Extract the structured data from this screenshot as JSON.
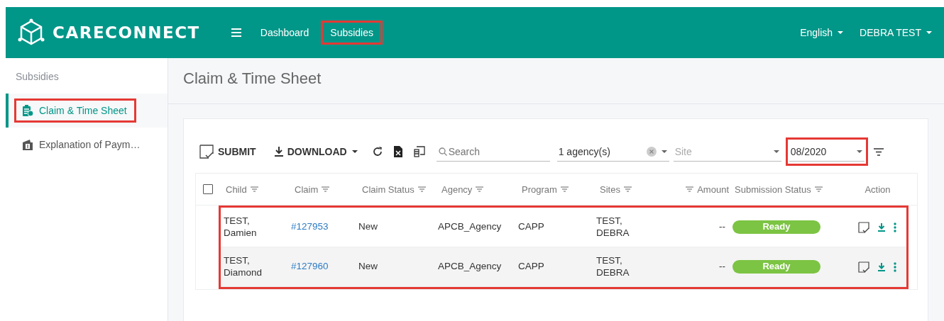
{
  "header": {
    "brand": "CARECONNECT",
    "nav": [
      {
        "label": "Dashboard",
        "highlighted": false
      },
      {
        "label": "Subsidies",
        "highlighted": true
      }
    ],
    "language": "English",
    "user": "DEBRA TEST"
  },
  "sidebar": {
    "heading": "Subsidies",
    "items": [
      {
        "label": "Claim & Time Sheet",
        "selected": true,
        "highlighted": true,
        "kind": "clipboard"
      },
      {
        "label": "Explanation of Paym…",
        "selected": false,
        "highlighted": false,
        "kind": "money"
      }
    ]
  },
  "page": {
    "title": "Claim & Time Sheet"
  },
  "toolbar": {
    "submit": "SUBMIT",
    "download": "DOWNLOAD",
    "search": {
      "placeholder": "Search"
    },
    "agency": {
      "value": "1 agency(s)"
    },
    "site": {
      "placeholder": "Site"
    },
    "period": {
      "value": "08/2020",
      "highlighted": true
    }
  },
  "table": {
    "select_all": {
      "checked": false
    },
    "columns": [
      {
        "label": "Child",
        "kind": "filterable"
      },
      {
        "label": "Claim",
        "kind": "filterable"
      },
      {
        "label": "Claim Status",
        "kind": "filterable"
      },
      {
        "label": "Agency",
        "kind": "filterable"
      },
      {
        "label": "Program",
        "kind": "filterable"
      },
      {
        "label": "Sites",
        "kind": "filterable"
      },
      {
        "label": "Amount",
        "kind": "numeric"
      },
      {
        "label": "Submission Status",
        "kind": "filterable"
      },
      {
        "label": "Action",
        "kind": "actions"
      }
    ],
    "rows_highlighted": true,
    "rows": [
      {
        "child": "TEST,\nDamien",
        "claim": "#127953",
        "claim_status": "New",
        "agency": "APCB_Agency",
        "program": "CAPP",
        "sites": "TEST,\nDEBRA",
        "amount": "--",
        "submission_status": "Ready"
      },
      {
        "child": "TEST,\nDiamond",
        "claim": "#127960",
        "claim_status": "New",
        "agency": "APCB_Agency",
        "program": "CAPP",
        "sites": "TEST,\nDEBRA",
        "amount": "--",
        "submission_status": "Ready"
      }
    ]
  }
}
